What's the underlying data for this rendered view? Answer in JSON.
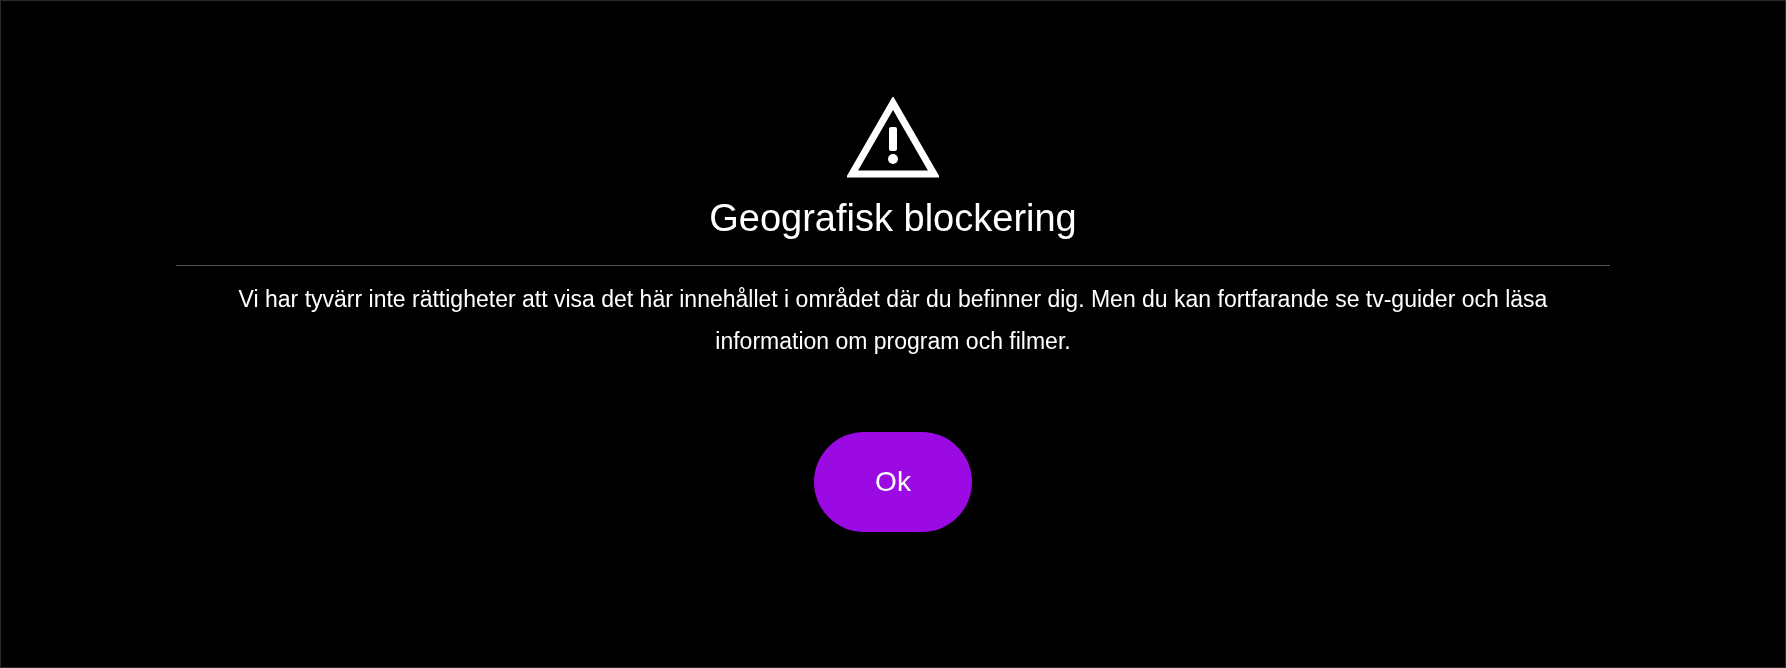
{
  "dialog": {
    "title": "Geografisk blockering",
    "message": "Vi har tyvärr inte rättigheter att visa det här innehållet i området där du befinner dig. Men du kan fortfarande se tv-guider och läsa information om program och filmer.",
    "buttons": [
      "Ok"
    ]
  }
}
